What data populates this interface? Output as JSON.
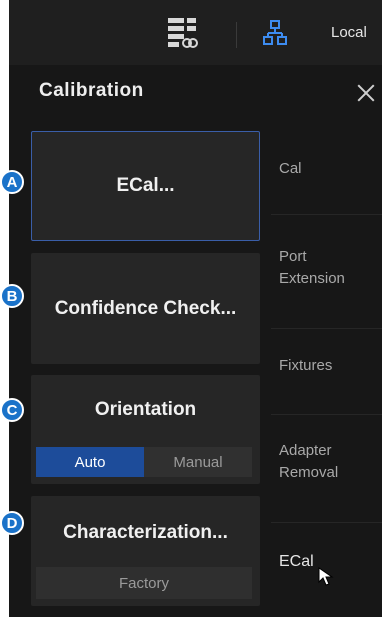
{
  "topbar": {
    "local_label": "Local"
  },
  "panel": {
    "title": "Calibration",
    "buttons": {
      "ecal": "ECal...",
      "confidence": "Confidence Check...",
      "orientation": "Orientation",
      "orientation_options": [
        "Auto",
        "Manual"
      ],
      "orientation_selected": "Auto",
      "characterization": "Characterization...",
      "characterization_source": "Factory"
    },
    "side_menu": [
      "Cal",
      "Port Extension",
      "Fixtures",
      "Adapter Removal",
      "ECal"
    ],
    "side_menu_active": "ECal"
  },
  "callouts": [
    "A",
    "B",
    "C",
    "D"
  ],
  "colors": {
    "accent": "#1d4c9a",
    "badge": "#1a72c9",
    "focus_border": "#3a5ea8"
  }
}
